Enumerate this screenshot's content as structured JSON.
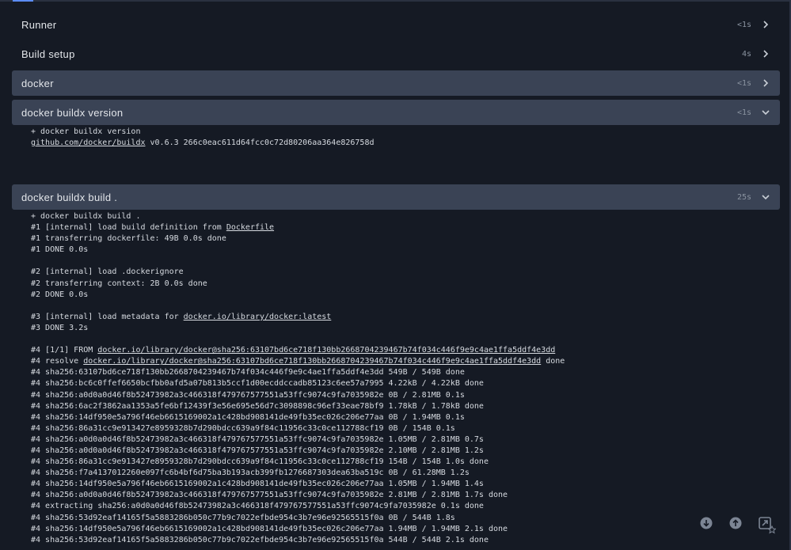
{
  "steps": [
    {
      "title": "Runner",
      "duration": "<1s",
      "expanded": false
    },
    {
      "title": "Build setup",
      "duration": "4s",
      "expanded": false
    },
    {
      "title": "docker",
      "duration": "<1s",
      "expanded": false
    },
    {
      "title": "docker buildx version",
      "duration": "<1s",
      "expanded": true
    },
    {
      "title": "docker buildx build .",
      "duration": "25s",
      "expanded": true
    }
  ],
  "version_log": [
    {
      "pre": "+ docker buildx version",
      "link": "",
      "post": ""
    },
    {
      "pre": "",
      "link": "github.com/docker/buildx",
      "post": " v0.6.3 266c0eac611d64fcc0c72d80206aa364e826758d"
    }
  ],
  "build_log": [
    {
      "pre": "+ docker buildx build .",
      "link": "",
      "post": ""
    },
    {
      "pre": "#1 [internal] load build definition from ",
      "link": "Dockerfile",
      "post": ""
    },
    {
      "pre": "#1 transferring dockerfile: 49B 0.0s done",
      "link": "",
      "post": ""
    },
    {
      "pre": "#1 DONE 0.0s",
      "link": "",
      "post": ""
    },
    {
      "pre": "",
      "link": "",
      "post": ""
    },
    {
      "pre": "#2 [internal] load .dockerignore",
      "link": "",
      "post": ""
    },
    {
      "pre": "#2 transferring context: 2B 0.0s done",
      "link": "",
      "post": ""
    },
    {
      "pre": "#2 DONE 0.0s",
      "link": "",
      "post": ""
    },
    {
      "pre": "",
      "link": "",
      "post": ""
    },
    {
      "pre": "#3 [internal] load metadata for ",
      "link": "docker.io/library/docker:latest",
      "post": ""
    },
    {
      "pre": "#3 DONE 3.2s",
      "link": "",
      "post": ""
    },
    {
      "pre": "",
      "link": "",
      "post": ""
    },
    {
      "pre": "#4 [1/1] FROM ",
      "link": "docker.io/library/docker@sha256:63107bd6ce718f130bb266870423946 7b74f034c446f9e9c4ae1ffa5ddf4e3dd",
      "post": ""
    },
    {
      "pre": "#4 resolve ",
      "link": "docker.io/library/docker@sha256:63107bd6ce718f130bb2668704239467b74f034c446f9e9c4ae1ffa5ddf4e3dd",
      "post": " done"
    },
    {
      "pre": "#4 sha256:63107bd6ce718f130bb2668704239467b74f034c446f9e9c4ae1ffa5ddf4e3dd 549B / 549B done",
      "link": "",
      "post": ""
    },
    {
      "pre": "#4 sha256:bc6c0ffef6650bcfbb0afd5a07b813b5ccf1d00ecddccadb85123c6ee57a7995 4.22kB / 4.22kB done",
      "link": "",
      "post": ""
    },
    {
      "pre": "#4 sha256:a0d0a0d46f8b52473982a3c466318f479767577551a53ffc9074c9fa7035982e 0B / 2.81MB 0.1s",
      "link": "",
      "post": ""
    },
    {
      "pre": "#4 sha256:6ac2f3862aa1353a5fe6bf12439f3e56e695e56d7c3098898c96ef33eae78bf9 1.78kB / 1.78kB done",
      "link": "",
      "post": ""
    },
    {
      "pre": "#4 sha256:14df950e5a796f46eb6615169002a1c428bd908141de49fb35ec026c206e77aa 0B / 1.94MB 0.1s",
      "link": "",
      "post": ""
    },
    {
      "pre": "#4 sha256:86a31cc9e913427e8959328b7d290bdcc639a9f84c11956c33c0ce112788cf19 0B / 154B 0.1s",
      "link": "",
      "post": ""
    },
    {
      "pre": "#4 sha256:a0d0a0d46f8b52473982a3c466318f479767577551a53ffc9074c9fa7035982e 1.05MB / 2.81MB 0.7s",
      "link": "",
      "post": ""
    },
    {
      "pre": "#4 sha256:a0d0a0d46f8b52473982a3c466318f479767577551a53ffc9074c9fa7035982e 2.10MB / 2.81MB 1.2s",
      "link": "",
      "post": ""
    },
    {
      "pre": "#4 sha256:86a31cc9e913427e8959328b7d290bdcc639a9f84c11956c33c0ce112788cf19 154B / 154B 1.0s done",
      "link": "",
      "post": ""
    },
    {
      "pre": "#4 sha256:f7a4137012260e097fc6b4bf6d75ba3b193acb399fb1276687303dea63ba519c 0B / 61.28MB 1.2s",
      "link": "",
      "post": ""
    },
    {
      "pre": "#4 sha256:14df950e5a796f46eb6615169002a1c428bd908141de49fb35ec026c206e77aa 1.05MB / 1.94MB 1.4s",
      "link": "",
      "post": ""
    },
    {
      "pre": "#4 sha256:a0d0a0d46f8b52473982a3c466318f479767577551a53ffc9074c9fa7035982e 2.81MB / 2.81MB 1.7s done",
      "link": "",
      "post": ""
    },
    {
      "pre": "#4 extracting sha256:a0d0a0d46f8b52473982a3c466318f479767577551a53ffc9074c9fa7035982e 0.1s done",
      "link": "",
      "post": ""
    },
    {
      "pre": "#4 sha256:53d92eaf14165f5a5883286b050c77b9c7022efbde954c3b7e96e92565515f0a 0B / 544B 1.8s",
      "link": "",
      "post": ""
    },
    {
      "pre": "#4 sha256:14df950e5a796f46eb6615169002a1c428bd908141de49fb35ec026c206e77aa 1.94MB / 1.94MB 2.1s done",
      "link": "",
      "post": ""
    },
    {
      "pre": "#4 sha256:53d92eaf14165f5a5883286b050c77b9c7022efbde954c3b7e96e92565515f0a 544B / 544B 2.1s done",
      "link": "",
      "post": ""
    }
  ],
  "floating_actions": [
    {
      "name": "download-icon"
    },
    {
      "name": "scroll-top-icon"
    },
    {
      "name": "expand-icon"
    }
  ],
  "colors": {
    "background": "#151a24",
    "active_step": "#3a4355",
    "accent": "#5b8cf5"
  }
}
